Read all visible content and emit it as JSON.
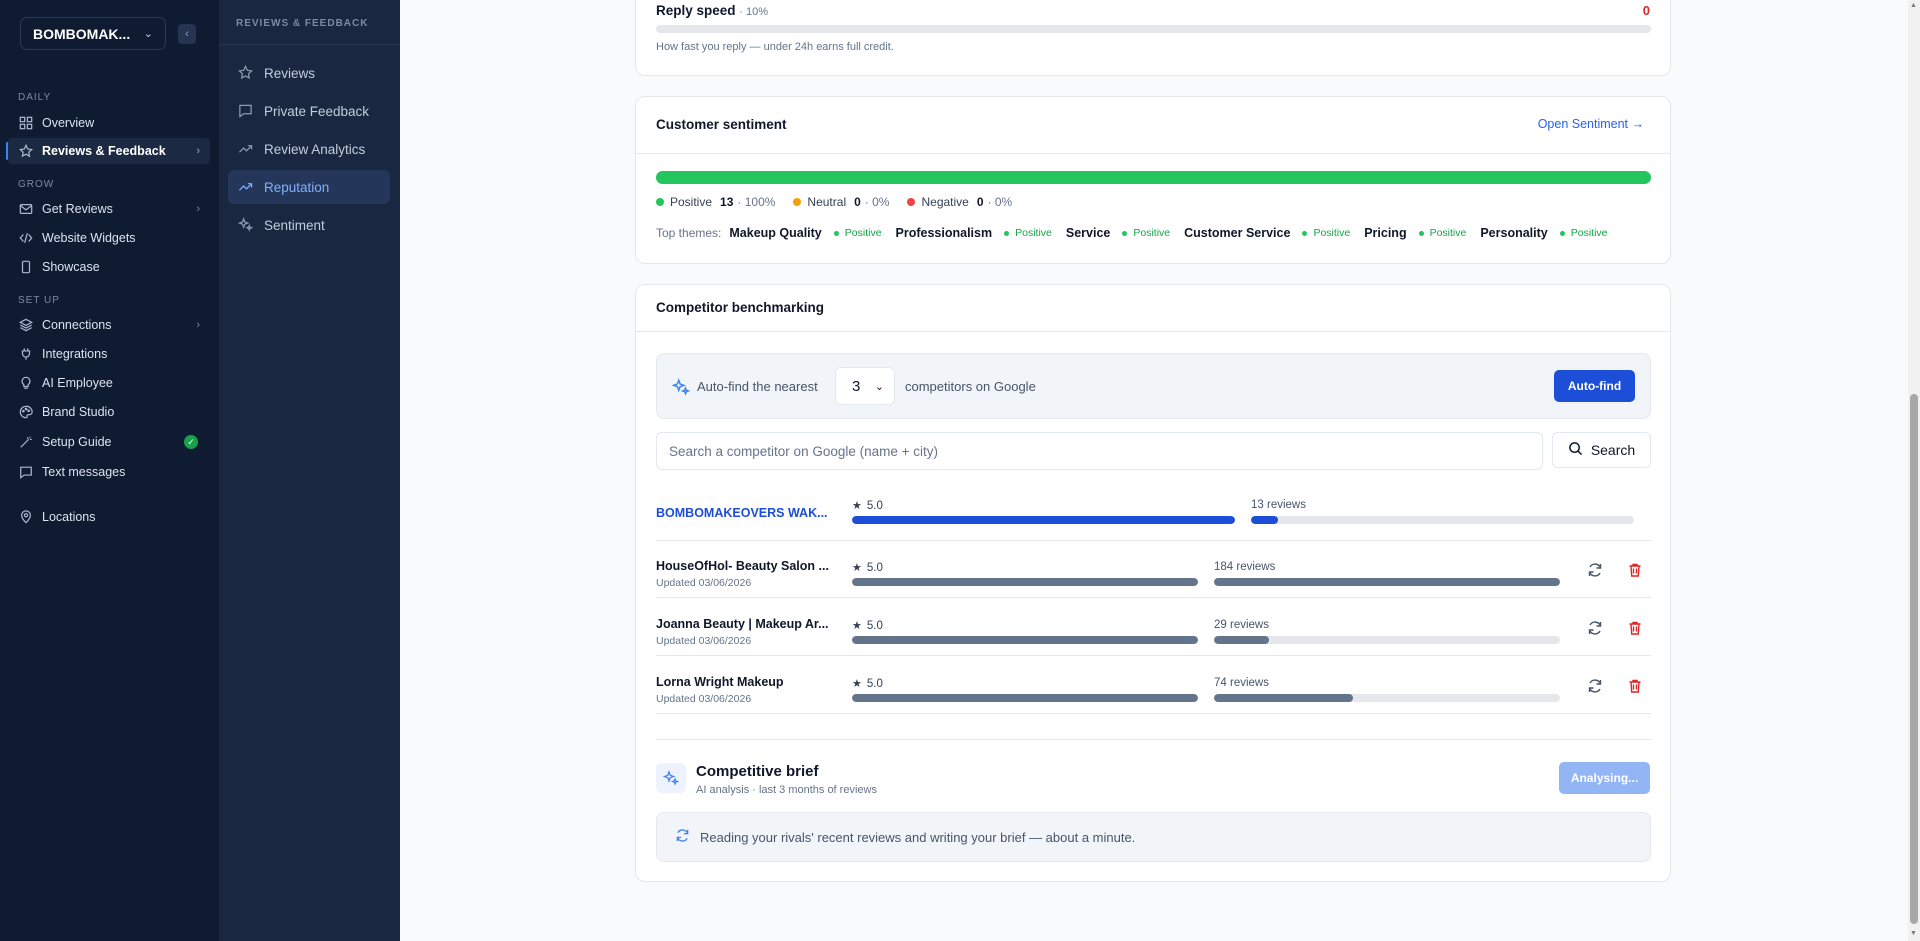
{
  "sidebar": {
    "workspace": "BOMBOMAK...",
    "sections": {
      "daily": "DAILY",
      "grow": "GROW",
      "setup": "SET UP"
    },
    "items": [
      {
        "label": "Overview",
        "icon": "grid-icon"
      },
      {
        "label": "Reviews & Feedback",
        "icon": "star-icon"
      },
      {
        "label": "Get Reviews",
        "icon": "mail-icon"
      },
      {
        "label": "Website Widgets",
        "icon": "code-icon"
      },
      {
        "label": "Showcase",
        "icon": "device-icon"
      },
      {
        "label": "Connections",
        "icon": "layers-icon"
      },
      {
        "label": "Integrations",
        "icon": "plug-icon"
      },
      {
        "label": "AI Employee",
        "icon": "bulb-icon"
      },
      {
        "label": "Brand Studio",
        "icon": "palette-icon"
      },
      {
        "label": "Setup Guide",
        "icon": "wand-icon"
      },
      {
        "label": "Text messages",
        "icon": "message-icon"
      },
      {
        "label": "Locations",
        "icon": "pin-icon"
      }
    ]
  },
  "subnav": {
    "title": "REVIEWS & FEEDBACK",
    "items": [
      {
        "label": "Reviews",
        "icon": "star-icon"
      },
      {
        "label": "Private Feedback",
        "icon": "message-icon"
      },
      {
        "label": "Review Analytics",
        "icon": "trend-icon"
      },
      {
        "label": "Reputation",
        "icon": "trend-icon"
      },
      {
        "label": "Sentiment",
        "icon": "sparkle-icon"
      }
    ]
  },
  "reply": {
    "title": "Reply speed",
    "weight": "· 10%",
    "value": "0",
    "hint": "How fast you reply — under 24h earns full credit."
  },
  "sentiment": {
    "title": "Customer sentiment",
    "link": "Open Sentiment →",
    "positive": {
      "label": "Positive",
      "count": "13",
      "pct": "· 100%",
      "fraction": 1.0
    },
    "neutral": {
      "label": "Neutral",
      "count": "0",
      "pct": "· 0%"
    },
    "negative": {
      "label": "Negative",
      "count": "0",
      "pct": "· 0%"
    },
    "themes_label": "Top themes:",
    "themes": [
      {
        "name": "Makeup Quality",
        "badge": "Positive"
      },
      {
        "name": "Professionalism",
        "badge": "Positive"
      },
      {
        "name": "Service",
        "badge": "Positive"
      },
      {
        "name": "Customer Service",
        "badge": "Positive"
      },
      {
        "name": "Pricing",
        "badge": "Positive"
      },
      {
        "name": "Personality",
        "badge": "Positive"
      }
    ],
    "colors": {
      "positive": "#22c55e",
      "neutral": "#f59e0b",
      "negative": "#ef4444"
    }
  },
  "competitors": {
    "title": "Competitor benchmarking",
    "autofind_prefix": "Auto-find the nearest",
    "autofind_count": "3",
    "autofind_suffix": "competitors on Google",
    "autofind_button": "Auto-find",
    "search_placeholder": "Search a competitor on Google (name + city)",
    "search_button": "Search",
    "own": {
      "name": "BOMBOMAKEOVERS WAK...",
      "rating": "5.0",
      "rating_fraction": 1.0,
      "reviews": "13 reviews",
      "reviews_fraction": 0.07
    },
    "rows": [
      {
        "name": "HouseOfHol- Beauty Salon ...",
        "updated": "Updated 03/06/2026",
        "rating": "5.0",
        "rating_fraction": 1.0,
        "reviews": "184 reviews",
        "reviews_fraction": 1.0
      },
      {
        "name": "Joanna Beauty | Makeup Ar...",
        "updated": "Updated 03/06/2026",
        "rating": "5.0",
        "rating_fraction": 1.0,
        "reviews": "29 reviews",
        "reviews_fraction": 0.158
      },
      {
        "name": "Lorna Wright Makeup",
        "updated": "Updated 03/06/2026",
        "rating": "5.0",
        "rating_fraction": 1.0,
        "reviews": "74 reviews",
        "reviews_fraction": 0.402
      }
    ],
    "colors": {
      "own": "#1d4ed8",
      "other": "#64748b"
    }
  },
  "brief": {
    "title": "Competitive brief",
    "subtitle": "AI analysis · last 3 months of reviews",
    "button": "Analysing...",
    "status": "Reading your rivals' recent reviews and writing your brief — about a minute."
  }
}
